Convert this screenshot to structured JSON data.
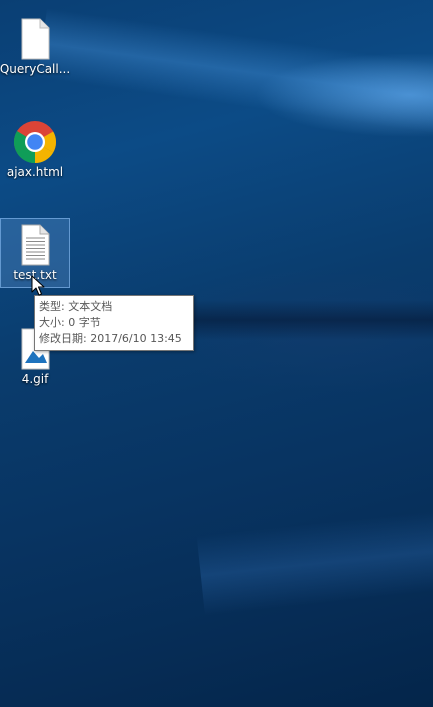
{
  "desktop": {
    "icons": [
      {
        "label": "QueryCall...",
        "icon": "text-file-icon"
      },
      {
        "label": "ajax.html",
        "icon": "chrome-icon"
      },
      {
        "label": "test.txt",
        "icon": "text-document-icon",
        "selected": true
      },
      {
        "label": "4.gif",
        "icon": "image-file-icon"
      }
    ]
  },
  "tooltip": {
    "type_line": "类型: 文本文档",
    "size_line": "大小: 0 字节",
    "modified_line": "修改日期: 2017/6/10 13:45"
  },
  "colors": {
    "wallpaper_dark": "#04254a",
    "wallpaper_mid": "#0c4b86",
    "selection": "#7aaae6",
    "tooltip_bg": "#ffffff",
    "tooltip_text": "#575757"
  }
}
